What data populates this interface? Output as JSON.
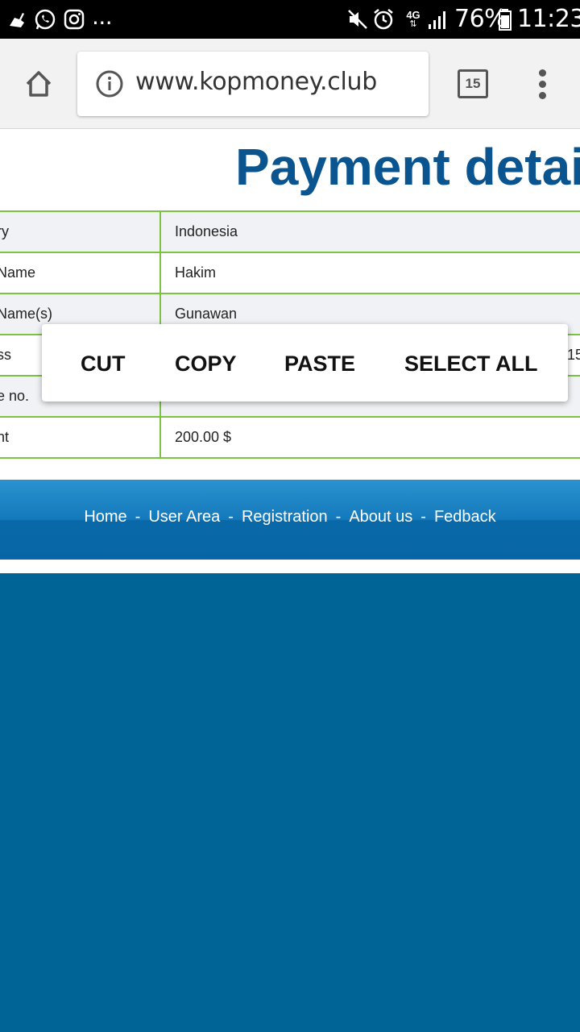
{
  "status_bar": {
    "battery": "76%",
    "time": "11:23",
    "network": "4G",
    "more": "...",
    "icons": [
      "cleaner-icon",
      "whatsapp-icon",
      "instagram-icon",
      "mute-icon",
      "alarm-icon",
      "data-4g-icon",
      "signal-icon",
      "battery-icon"
    ]
  },
  "browser": {
    "url": "www.kopmoney.club",
    "tab_count": "15"
  },
  "page": {
    "title": "Payment details",
    "rows": [
      {
        "label": "ry",
        "value": "Indonesia",
        "extra": ""
      },
      {
        "label": "Name",
        "value": "Hakim",
        "extra": ""
      },
      {
        "label": "Name(s)",
        "value": "Gunawan",
        "extra": ""
      },
      {
        "label": "ss",
        "value": "",
        "extra": "15"
      },
      {
        "label": "e no.",
        "value": "",
        "extra": ""
      },
      {
        "label": "nt",
        "value": "200.00 $",
        "extra": ""
      }
    ]
  },
  "context_menu": {
    "cut": "CUT",
    "copy": "COPY",
    "paste": "PASTE",
    "select_all": "SELECT ALL"
  },
  "footer": {
    "links": [
      "Home",
      "User Area",
      "Registration",
      "About us",
      "Fedback"
    ],
    "separator": "-"
  },
  "colors": {
    "title": "#0a5590",
    "table_border": "#7cc243",
    "footer_bottom": "#006496"
  }
}
